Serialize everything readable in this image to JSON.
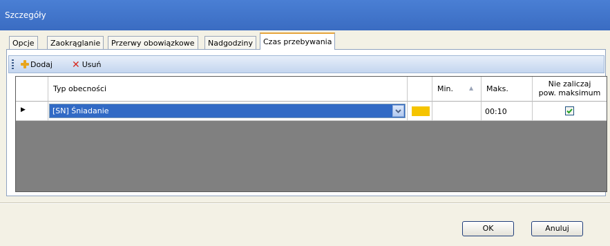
{
  "window": {
    "title": "Szczegóły"
  },
  "tabs": [
    {
      "label": "Opcje"
    },
    {
      "label": "Zaokrąglanie"
    },
    {
      "label": "Przerwy obowiązkowe"
    },
    {
      "label": "Nadgodziny"
    },
    {
      "label": "Czas przebywania"
    }
  ],
  "active_tab": "Czas przebywania",
  "toolbar": {
    "add_label": "Dodaj",
    "remove_label": "Usuń"
  },
  "grid": {
    "columns": {
      "type": "Typ obecności",
      "min": "Min.",
      "max": "Maks.",
      "exclude_line1": "Nie zaliczaj",
      "exclude_line2": "pow. maksimum"
    },
    "rows": [
      {
        "type": "[SN]  Śniadanie",
        "color": "#f5c400",
        "min": "",
        "max": "00:10",
        "exclude": true
      }
    ]
  },
  "buttons": {
    "ok": "OK",
    "cancel": "Anuluj"
  },
  "colors": {
    "titlebar": "#4a7fd4",
    "selection": "#316ac5",
    "grid_empty": "#808080"
  }
}
